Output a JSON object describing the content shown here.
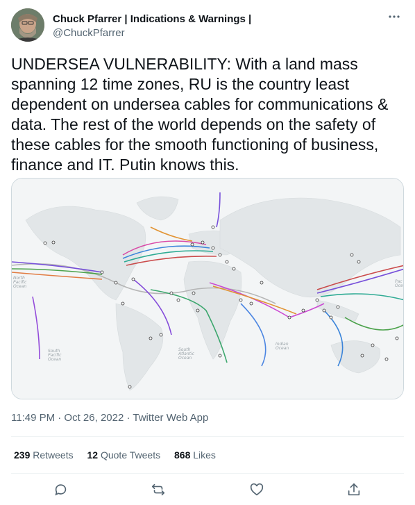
{
  "tweet": {
    "display_name": "Chuck Pfarrer | Indications & Warnings |",
    "handle": "@ChuckPfarrer",
    "more_icon": "more-icon",
    "text": "UNDERSEA VULNERABILITY: With a land mass spanning 12 time zones, RU is the country least dependent on undersea cables for communications & data. The rest of the world depends on the safety of these cables for the smooth functioning of business, finance and IT. Putin knows this.",
    "timestamp": "11:49 PM · Oct 26, 2022 · Twitter Web App"
  },
  "media": {
    "ocean_labels": {
      "north_pacific": "North Pacific Ocean",
      "south_pacific": "South Pacific Ocean",
      "south_atlantic": "South Atlantic Ocean",
      "indian": "Indian Ocean",
      "right_edge": "Pac Oce"
    }
  },
  "stats": {
    "retweets_count": "239",
    "retweets_label": "Retweets",
    "quotes_count": "12",
    "quotes_label": "Quote Tweets",
    "likes_count": "868",
    "likes_label": "Likes"
  },
  "actions": {
    "reply_icon": "reply-icon",
    "retweet_icon": "retweet-icon",
    "like_icon": "like-icon",
    "share_icon": "share-icon"
  },
  "colors": {
    "text": "#0f1419",
    "secondary": "#536471",
    "border": "#cfd9de",
    "divider": "#eff3f4"
  }
}
